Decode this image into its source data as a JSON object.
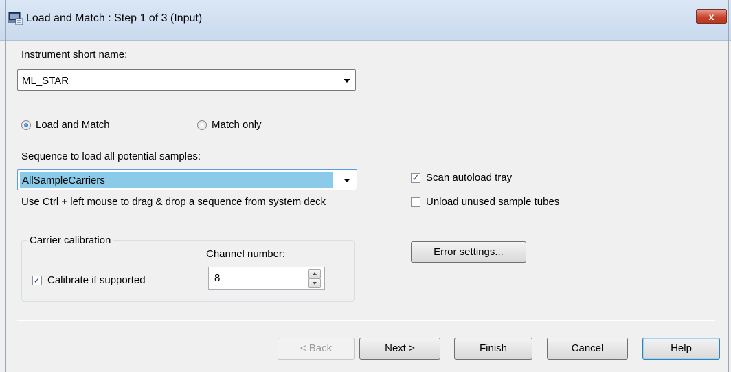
{
  "window": {
    "title": "Load and Match : Step 1 of 3 (Input)",
    "close_label": "x"
  },
  "instrument": {
    "label": "Instrument short name:",
    "value": "ML_STAR"
  },
  "mode": {
    "option_load_and_match": "Load and Match",
    "option_match_only": "Match only",
    "selected": "Load and Match"
  },
  "sequence": {
    "label": "Sequence to load all potential samples:",
    "value": "AllSampleCarriers",
    "hint": "Use Ctrl + left mouse to drag & drop a sequence from system deck"
  },
  "options": {
    "scan_autoload_tray": "Scan autoload tray",
    "scan_autoload_tray_checked": true,
    "unload_unused_tubes": "Unload unused sample tubes",
    "unload_unused_tubes_checked": false
  },
  "carrier_calibration": {
    "group_label": "Carrier calibration",
    "calibrate_label": "Calibrate if supported",
    "calibrate_checked": true,
    "channel_label": "Channel number:",
    "channel_value": "8"
  },
  "buttons": {
    "error_settings": "Error settings...",
    "back": "< Back",
    "next": "Next >",
    "finish": "Finish",
    "cancel": "Cancel",
    "help": "Help"
  },
  "colors": {
    "selection_highlight": "#89cbe8",
    "title_bar": "#c9daee",
    "close_button": "#c7422d"
  }
}
